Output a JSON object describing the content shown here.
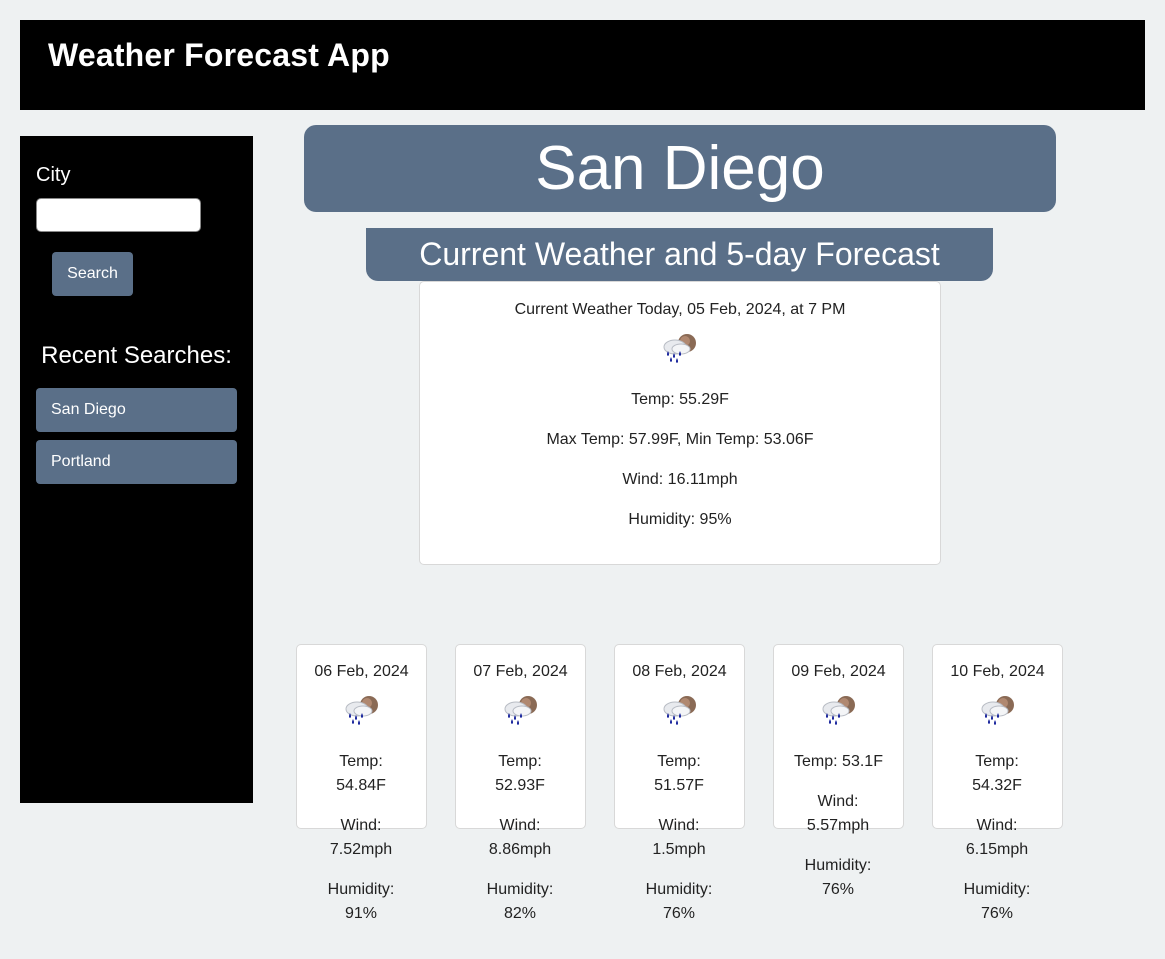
{
  "app": {
    "title": "Weather Forecast App"
  },
  "sidebar": {
    "city_label": "City",
    "city_value": "",
    "search_label": "Search",
    "recent_title": "Recent Searches:",
    "recent": [
      "San Diego",
      "Portland"
    ]
  },
  "main": {
    "city": "San Diego",
    "subtitle": "Current Weather and 5-day Forecast",
    "current": {
      "heading": "Current Weather Today, 05 Feb, 2024, at 7 PM",
      "icon": "rain-cloud-icon",
      "temp": "Temp: 55.29F",
      "maxmin": "Max Temp: 57.99F, Min Temp: 53.06F",
      "wind": "Wind: 16.11mph",
      "humidity": "Humidity: 95%"
    },
    "forecast": [
      {
        "date": "06 Feb, 2024",
        "temp": "Temp: 54.84F",
        "wind": "Wind: 7.52mph",
        "humidity": "Humidity: 91%",
        "icon": "rain-cloud-icon"
      },
      {
        "date": "07 Feb, 2024",
        "temp": "Temp: 52.93F",
        "wind": "Wind: 8.86mph",
        "humidity": "Humidity: 82%",
        "icon": "rain-cloud-icon"
      },
      {
        "date": "08 Feb, 2024",
        "temp": "Temp: 51.57F",
        "wind": "Wind: 1.5mph",
        "humidity": "Humidity: 76%",
        "icon": "rain-cloud-icon"
      },
      {
        "date": "09 Feb, 2024",
        "temp": "Temp: 53.1F",
        "wind": "Wind: 5.57mph",
        "humidity": "Humidity: 76%",
        "icon": "rain-cloud-icon"
      },
      {
        "date": "10 Feb, 2024",
        "temp": "Temp: 54.32F",
        "wind": "Wind: 6.15mph",
        "humidity": "Humidity: 76%",
        "icon": "rain-cloud-icon"
      }
    ]
  }
}
